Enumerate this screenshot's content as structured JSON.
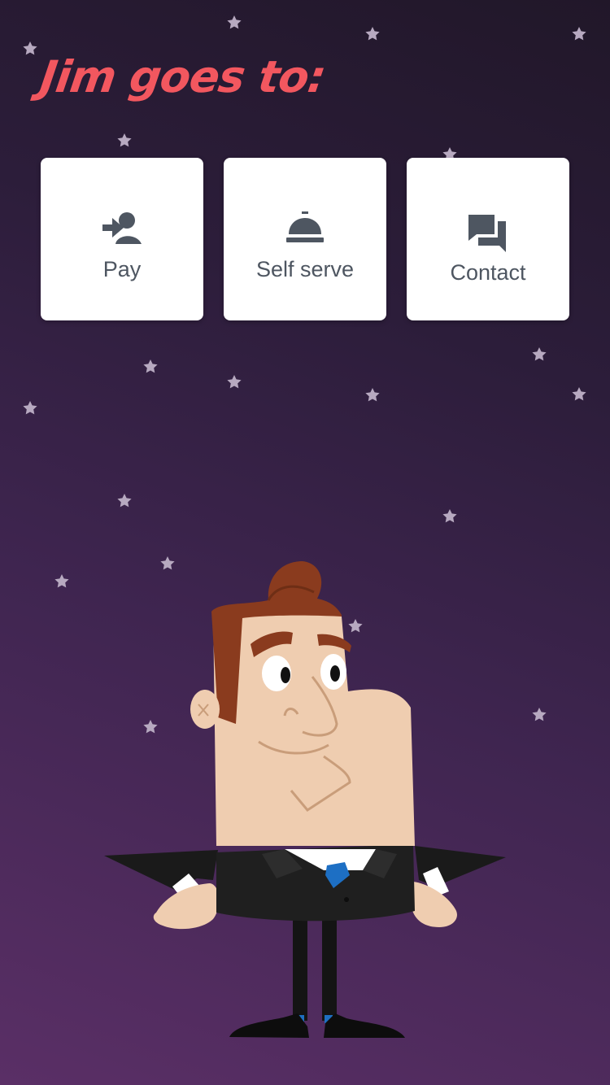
{
  "title": "Jim goes to:",
  "tiles": [
    {
      "label": "Pay",
      "icon": "pay-icon"
    },
    {
      "label": "Self serve",
      "icon": "bell-icon"
    },
    {
      "label": "Contact",
      "icon": "chat-icon"
    }
  ],
  "colors": {
    "background_top": "#211729",
    "background_bottom": "#5a2f66",
    "title": "#f2575f",
    "tile": "#ffffff",
    "tile_text": "#4e5661",
    "star": "#b7a9c0"
  }
}
